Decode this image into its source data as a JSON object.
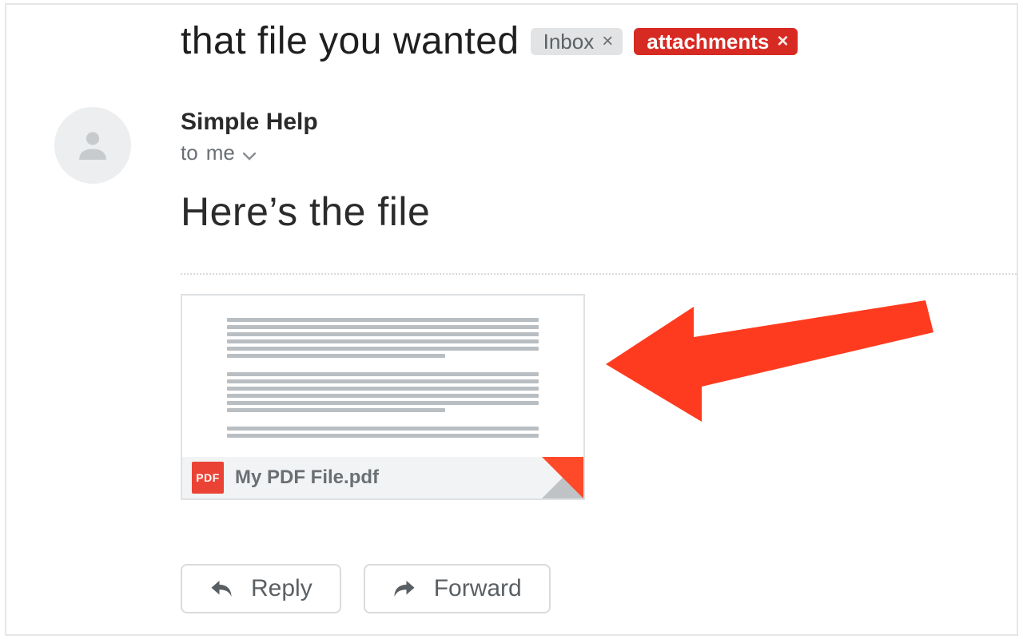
{
  "subject": "that file you wanted",
  "labels": {
    "inbox": "Inbox",
    "attachments": "attachments"
  },
  "sender": "Simple Help",
  "recipient_prefix": "to",
  "recipient": "me",
  "body": "Here’s the file",
  "attachment": {
    "badge": "PDF",
    "filename": "My PDF File.pdf"
  },
  "actions": {
    "reply": "Reply",
    "forward": "Forward"
  }
}
